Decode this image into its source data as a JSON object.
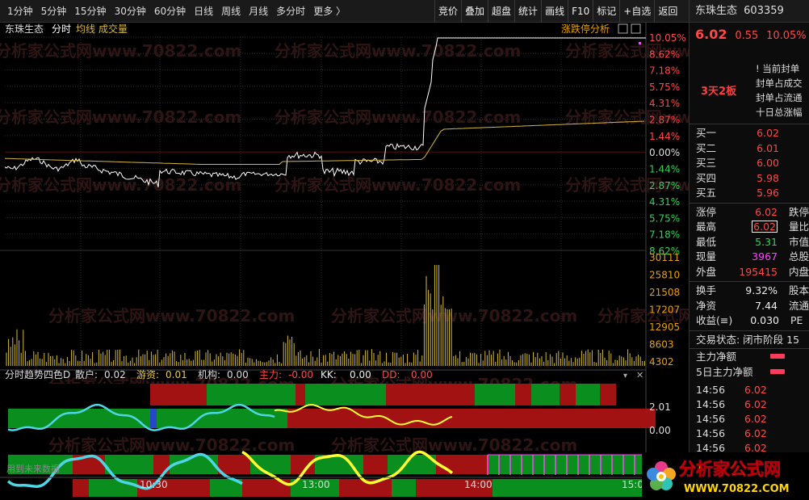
{
  "periods": [
    "1分钟",
    "5分钟",
    "15分钟",
    "30分钟",
    "60分钟",
    "日线",
    "周线",
    "月线",
    "多分时",
    "更多 〉"
  ],
  "toolbar": [
    "竞价",
    "叠加",
    "超盘",
    "统计",
    "画线",
    "F10",
    "标记",
    "+自选",
    "返回"
  ],
  "chart": {
    "legend": [
      "东珠生态",
      "分时",
      "均线",
      "成交量"
    ],
    "limit_link": "涨跌停分析",
    "pct_labels": [
      "10.05%",
      "8.62%",
      "7.18%",
      "5.75%",
      "4.31%",
      "2.87%",
      "1.44%",
      "0.00%",
      "1.44%",
      "2.87%",
      "4.31%",
      "5.75%",
      "7.18%",
      "8.62%"
    ],
    "vol_labels": [
      "30111",
      "25810",
      "21508",
      "17207",
      "12905",
      "8603",
      "4302"
    ],
    "indicator_title": "分时趋势四色D",
    "indicator_items": [
      {
        "label": "散户:",
        "value": "0.02",
        "color": "#ddd"
      },
      {
        "label": "游资:",
        "value": "0.01",
        "color": "#e8c84a"
      },
      {
        "label": "机构:",
        "value": "0.00",
        "color": "#ddd"
      },
      {
        "label": "主力:",
        "value": "-0.00",
        "color": "#ff4747"
      },
      {
        "label": "KK:",
        "value": "0.00",
        "color": "#eee"
      },
      {
        "label": "DD:",
        "value": "0.00",
        "color": "#ff4747"
      }
    ],
    "ind_labels": [
      "2.01",
      "0.00"
    ],
    "future_label": "用到未来数据",
    "time_labels": [
      "10:30",
      "13:00",
      "14:00",
      "15:00"
    ],
    "watermark": "分析家公式网www.70822.com",
    "colors": {
      "rise": "#ff4747",
      "fall": "#30d35a",
      "avg": "#d8b83a",
      "price": "#ffffff"
    }
  },
  "stock": {
    "name": "东珠生态",
    "code": "603359",
    "price": "6.02",
    "change": "0.55",
    "pct": "10.05%"
  },
  "board": "3天2板",
  "seal_info": [
    "! 当前封单",
    "封单占成交",
    "封单占流通",
    "十日总涨幅"
  ],
  "orders": [
    {
      "label": "买一",
      "value": "6.02"
    },
    {
      "label": "买二",
      "value": "6.01"
    },
    {
      "label": "买三",
      "value": "6.00"
    },
    {
      "label": "买四",
      "value": "5.98"
    },
    {
      "label": "买五",
      "value": "5.96"
    }
  ],
  "quote": [
    {
      "label": "涨停",
      "value": "6.02",
      "cls": "red",
      "label2": "跌停"
    },
    {
      "label": "最高",
      "value": "6.02",
      "cls": "red boxed",
      "label2": "量比"
    },
    {
      "label": "最低",
      "value": "5.31",
      "cls": "green",
      "label2": "市值"
    },
    {
      "label": "现量",
      "value": "3967",
      "cls": "magenta",
      "label2": "总股"
    },
    {
      "label": "外盘",
      "value": "195415",
      "cls": "red",
      "label2": "内盘"
    }
  ],
  "stats": [
    {
      "label": "换手",
      "value": "9.32%",
      "label2": "股本"
    },
    {
      "label": "净资",
      "value": "7.44",
      "label2": "流通"
    },
    {
      "label": "收益(≡)",
      "value": "0.030",
      "label2": "PE"
    }
  ],
  "trade_state": "交易状态: 闭市阶段 15",
  "flows": [
    "主力净额",
    "5日主力净额"
  ],
  "ticks": [
    {
      "time": "14:56",
      "price": "6.02"
    },
    {
      "time": "14:56",
      "price": "6.02"
    },
    {
      "time": "14:56",
      "price": "6.02"
    },
    {
      "time": "14:56",
      "price": "6.02"
    },
    {
      "time": "14:56",
      "price": "6.02"
    }
  ],
  "logo": {
    "text": "分析家公式网",
    "url": "WWW.70822.COM"
  }
}
